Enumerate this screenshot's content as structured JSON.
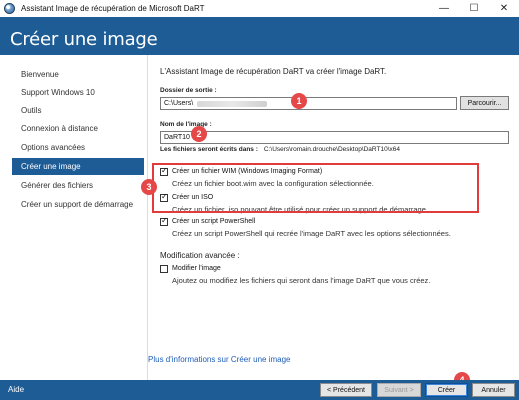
{
  "window": {
    "title": "Assistant Image de récupération de Microsoft DaRT",
    "controls": [
      "—",
      "☐",
      "✕"
    ]
  },
  "header": {
    "title": "Créer une image"
  },
  "sidebar": {
    "items": [
      {
        "label": "Bienvenue",
        "active": false
      },
      {
        "label": "Support Windows 10",
        "active": false
      },
      {
        "label": "Outils",
        "active": false
      },
      {
        "label": "Connexion à distance",
        "active": false
      },
      {
        "label": "Options avancées",
        "active": false
      },
      {
        "label": "Créer une image",
        "active": true
      },
      {
        "label": "Générer des fichiers",
        "active": false
      },
      {
        "label": "Créer un support de démarrage",
        "active": false
      }
    ]
  },
  "main": {
    "intro": "L'Assistant Image de récupération DaRT va créer l'image DaRT.",
    "output_folder": {
      "label": "Dossier de sortie :",
      "value": "C:\\Users\\",
      "browse_label": "Parcourir..."
    },
    "image_name": {
      "label": "Nom de l'image :",
      "value": "DaRT10"
    },
    "files_written": {
      "label": "Les fichiers seront écrits dans :",
      "path": "C:\\Users\\romain.drouche\\Desktop\\DaRT10\\x64"
    },
    "options": [
      {
        "title": "Créer un fichier WIM (Windows Imaging Format)",
        "desc": "Créez un fichier boot.wim avec la configuration sélectionnée.",
        "checked": true
      },
      {
        "title": "Créer un ISO",
        "desc": "Créez un fichier .iso pouvant être utilisé pour créer un support de démarrage.",
        "checked": true
      },
      {
        "title": "Créer un script PowerShell",
        "desc": "Créez un script PowerShell qui recrée l'image DaRT avec les options sélectionnées.",
        "checked": true
      }
    ],
    "advanced": {
      "title": "Modification avancée :",
      "option": {
        "title": "Modifier l'image",
        "desc": "Ajoutez ou modifiez les fichiers qui seront dans l'image DaRT que vous créez.",
        "checked": false
      }
    },
    "more_info_link": "Plus d'informations sur Créer une image"
  },
  "footer": {
    "help": "Aide",
    "buttons": {
      "previous": "< Précédent",
      "next": "Suivant >",
      "create": "Créer",
      "cancel": "Annuler"
    }
  },
  "annotations": [
    "1",
    "2",
    "3",
    "4"
  ],
  "colors": {
    "header_bg": "#1e5c96",
    "annotation_red": "#e54848",
    "link_blue": "#1f5eb8"
  }
}
